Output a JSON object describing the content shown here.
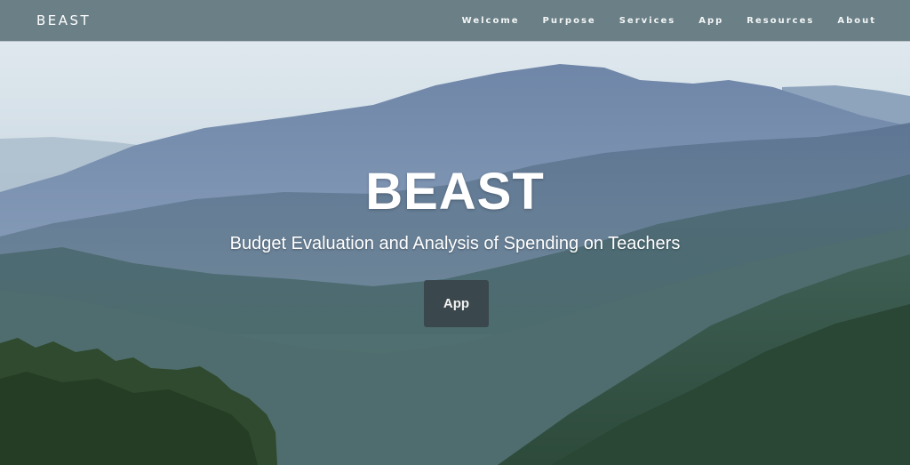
{
  "navbar": {
    "brand": "BEAST",
    "links": [
      {
        "label": "Welcome"
      },
      {
        "label": "Purpose"
      },
      {
        "label": "Services"
      },
      {
        "label": "App"
      },
      {
        "label": "Resources"
      },
      {
        "label": "About"
      }
    ]
  },
  "hero": {
    "title": "BEAST",
    "subtitle": "Budget Evaluation and Analysis of Spending on Teachers",
    "button_label": "App",
    "background": "mountain-landscape-photo"
  },
  "colors": {
    "navbar_bg": "#6a7f86",
    "button_bg": "#384248",
    "text": "#ffffff"
  }
}
